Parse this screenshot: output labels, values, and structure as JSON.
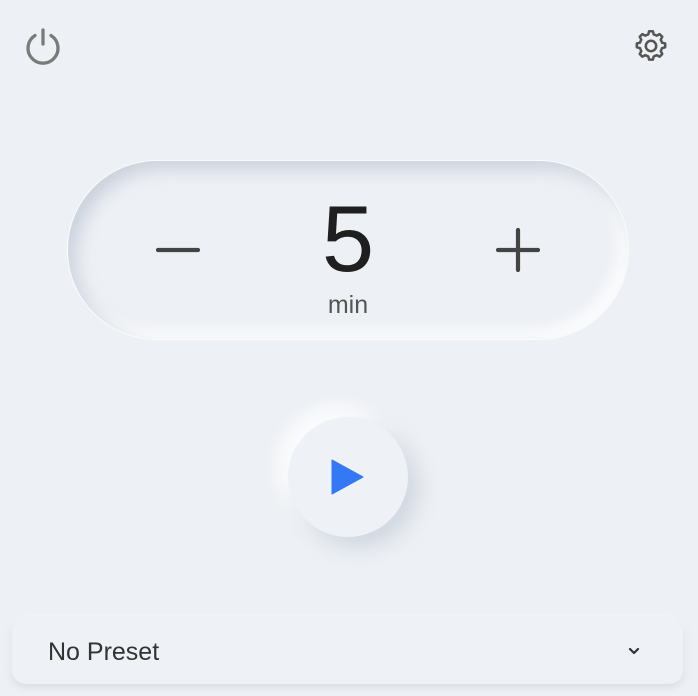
{
  "header": {
    "power_icon": "power-icon",
    "settings_icon": "gear-icon"
  },
  "timer": {
    "decrement_icon": "minus-icon",
    "increment_icon": "plus-icon",
    "value": "5",
    "unit": "min"
  },
  "controls": {
    "play_icon": "play-icon",
    "play_color": "#3478f6"
  },
  "preset": {
    "selected": "No Preset",
    "dropdown_icon": "chevron-down-icon"
  }
}
